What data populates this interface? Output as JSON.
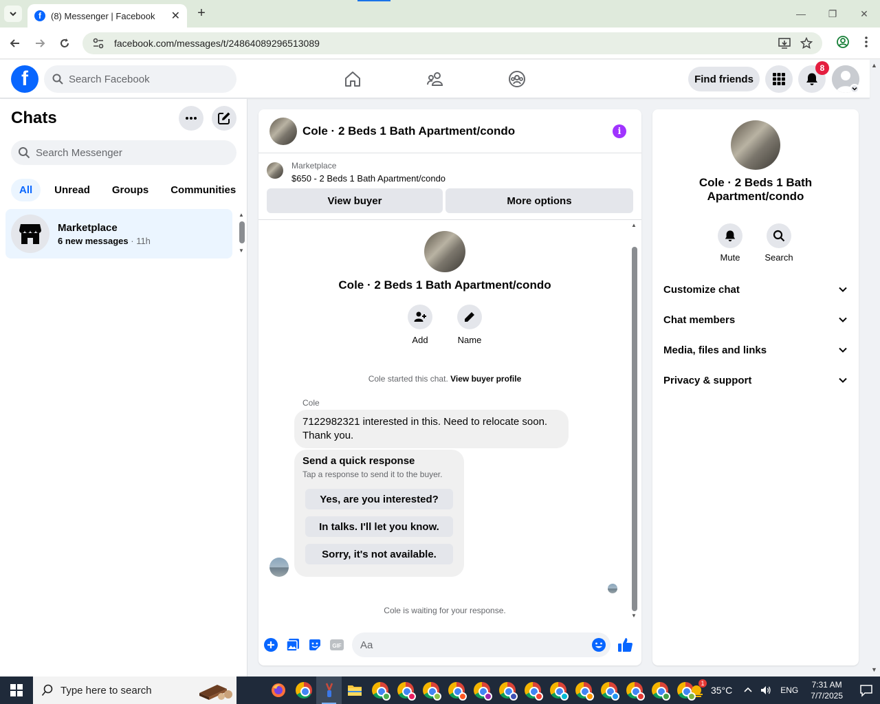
{
  "browser": {
    "tab_title": "(8) Messenger | Facebook",
    "favicon_letter": "f",
    "url": "facebook.com/messages/t/24864089296513089"
  },
  "fb_header": {
    "logo_letter": "f",
    "search_placeholder": "Search Facebook",
    "find_friends_label": "Find friends",
    "notification_count": "8"
  },
  "chats_pane": {
    "title": "Chats",
    "search_placeholder": "Search Messenger",
    "filters": [
      "All",
      "Unread",
      "Groups",
      "Communities"
    ],
    "active_filter": "All",
    "conversations": [
      {
        "name": "Marketplace",
        "preview": "6 new messages",
        "separator": " · ",
        "time": "11h"
      }
    ]
  },
  "conversation": {
    "title": "Cole · 2 Beds 1 Bath Apartment/condo",
    "marketplace_label": "Marketplace",
    "listing": "$650 - 2 Beds 1 Bath Apartment/condo",
    "view_buyer_label": "View buyer",
    "more_options_label": "More options",
    "thread_name": "Cole · 2 Beds 1 Bath Apartment/condo",
    "add_label": "Add",
    "name_label": "Name",
    "started_text": "Cole started this chat.",
    "view_profile_link": "View buyer profile",
    "sender_name": "Cole",
    "message_line1": "7122982321 interested in this. Need to relocate soon.",
    "message_line2": "Thank you.",
    "quick_title": "Send a quick response",
    "quick_subtitle": "Tap a response to send it to the buyer.",
    "quick_responses": [
      "Yes, are you interested?",
      "In talks. I'll let you know.",
      "Sorry, it's not available."
    ],
    "waiting_text": "Cole is waiting for your response.",
    "composer_placeholder": "Aa"
  },
  "info_pane": {
    "name": "Cole · 2 Beds 1 Bath Apartment/condo",
    "mute_label": "Mute",
    "search_label": "Search",
    "sections": [
      "Customize chat",
      "Chat members",
      "Media, files and links",
      "Privacy & support"
    ]
  },
  "taskbar": {
    "search_placeholder": "Type here to search",
    "temperature": "35°C",
    "weather_alert_count": "1",
    "language": "ENG",
    "time": "7:31 AM",
    "date": "7/7/2025"
  },
  "colors": {
    "facebook_blue": "#0866ff",
    "info_purple": "#a033ff",
    "notification_red": "#e41e3f",
    "selected_bg": "#ebf5ff"
  }
}
